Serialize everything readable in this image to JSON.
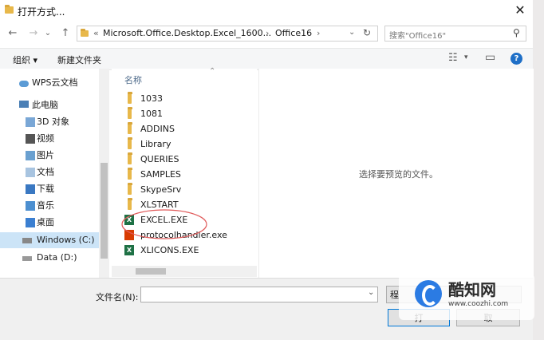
{
  "window": {
    "title": "打开方式...",
    "close_glyph": "✕"
  },
  "nav": {
    "back_glyph": "←",
    "forward_glyph": "→",
    "dropdown_glyph": "⌄",
    "up_glyph": "↑",
    "path_prefix": "«",
    "path_parts": [
      "Microsoft.Office.Desktop.Excel_1600...",
      "Office16"
    ],
    "path_separator": "›",
    "refresh_glyph": "↻",
    "search_placeholder": "搜索\"Office16\"",
    "search_glyph": "⚲"
  },
  "toolbar": {
    "organize_label": "组织 ▾",
    "new_folder_label": "新建文件夹",
    "view_glyph": "☷",
    "view_dropdown_glyph": "▾",
    "pane_glyph": "▭",
    "help_glyph": "?"
  },
  "sidebar": {
    "items": [
      {
        "label": "WPS云文档",
        "icon": "cloud-icon"
      },
      {
        "label": "此电脑",
        "icon": "computer-icon"
      },
      {
        "label": "3D 对象",
        "icon": "3d-objects-icon"
      },
      {
        "label": "视频",
        "icon": "video-icon"
      },
      {
        "label": "图片",
        "icon": "pictures-icon"
      },
      {
        "label": "文档",
        "icon": "documents-icon"
      },
      {
        "label": "下载",
        "icon": "downloads-icon"
      },
      {
        "label": "音乐",
        "icon": "music-icon"
      },
      {
        "label": "桌面",
        "icon": "desktop-icon"
      },
      {
        "label": "Windows (C:)",
        "icon": "drive-c-icon"
      },
      {
        "label": "Data (D:)",
        "icon": "drive-d-icon"
      }
    ],
    "selected_index": 9
  },
  "filelist": {
    "column_header": "名称",
    "sort_glyph": "⌃",
    "items": [
      {
        "label": "1033",
        "type": "folder"
      },
      {
        "label": "1081",
        "type": "folder"
      },
      {
        "label": "ADDINS",
        "type": "folder"
      },
      {
        "label": "Library",
        "type": "folder"
      },
      {
        "label": "QUERIES",
        "type": "folder"
      },
      {
        "label": "SAMPLES",
        "type": "folder"
      },
      {
        "label": "SkypeSrv",
        "type": "folder"
      },
      {
        "label": "XLSTART",
        "type": "folder"
      },
      {
        "label": "EXCEL.EXE",
        "type": "excel"
      },
      {
        "label": "protocolhandler.exe",
        "type": "office"
      },
      {
        "label": "XLICONS.EXE",
        "type": "excel"
      }
    ],
    "highlight_color": "#e05a5a"
  },
  "preview": {
    "message": "选择要预览的文件。"
  },
  "bottom": {
    "filename_label": "文件名(N):",
    "filename_value": "",
    "filetype_label": "程",
    "open_label": "打",
    "cancel_label": "取"
  },
  "watermark": {
    "name": "酷知网",
    "url": "www.coozhi.com"
  },
  "colors": {
    "selection": "#cce4f7",
    "folder": "#e8b84a",
    "excel_green": "#1e7145",
    "office_red": "#d83b01",
    "help_blue": "#1e6fc7"
  }
}
